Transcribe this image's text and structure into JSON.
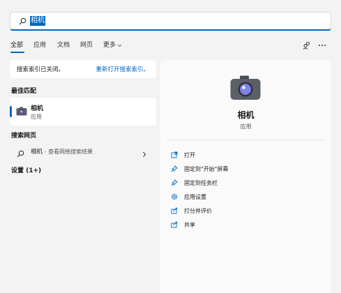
{
  "search": {
    "query": "相机"
  },
  "tabs": [
    {
      "label": "全部"
    },
    {
      "label": "应用"
    },
    {
      "label": "文档"
    },
    {
      "label": "网页"
    },
    {
      "label": "更多"
    }
  ],
  "notice": {
    "text": "搜索索引已关闭。",
    "link": "重新打开搜索索引。"
  },
  "best_match": {
    "heading": "最佳匹配",
    "name": "相机",
    "type": "应用"
  },
  "web": {
    "heading": "搜索网页",
    "query": "相机",
    "suffix": " - 查看网络搜索结果"
  },
  "settings": {
    "heading": "设置 (1+)"
  },
  "detail": {
    "title": "相机",
    "subtitle": "应用",
    "actions": [
      {
        "label": "打开",
        "icon": "open-icon"
      },
      {
        "label": "固定到\"开始\"屏幕",
        "icon": "pin-icon"
      },
      {
        "label": "固定到任务栏",
        "icon": "pin-icon"
      },
      {
        "label": "应用设置",
        "icon": "gear-icon"
      },
      {
        "label": "打分并评价",
        "icon": "share-icon"
      },
      {
        "label": "共享",
        "icon": "share-icon"
      }
    ]
  },
  "colors": {
    "accent": "#0067c0",
    "background": "#f3f3f3"
  }
}
